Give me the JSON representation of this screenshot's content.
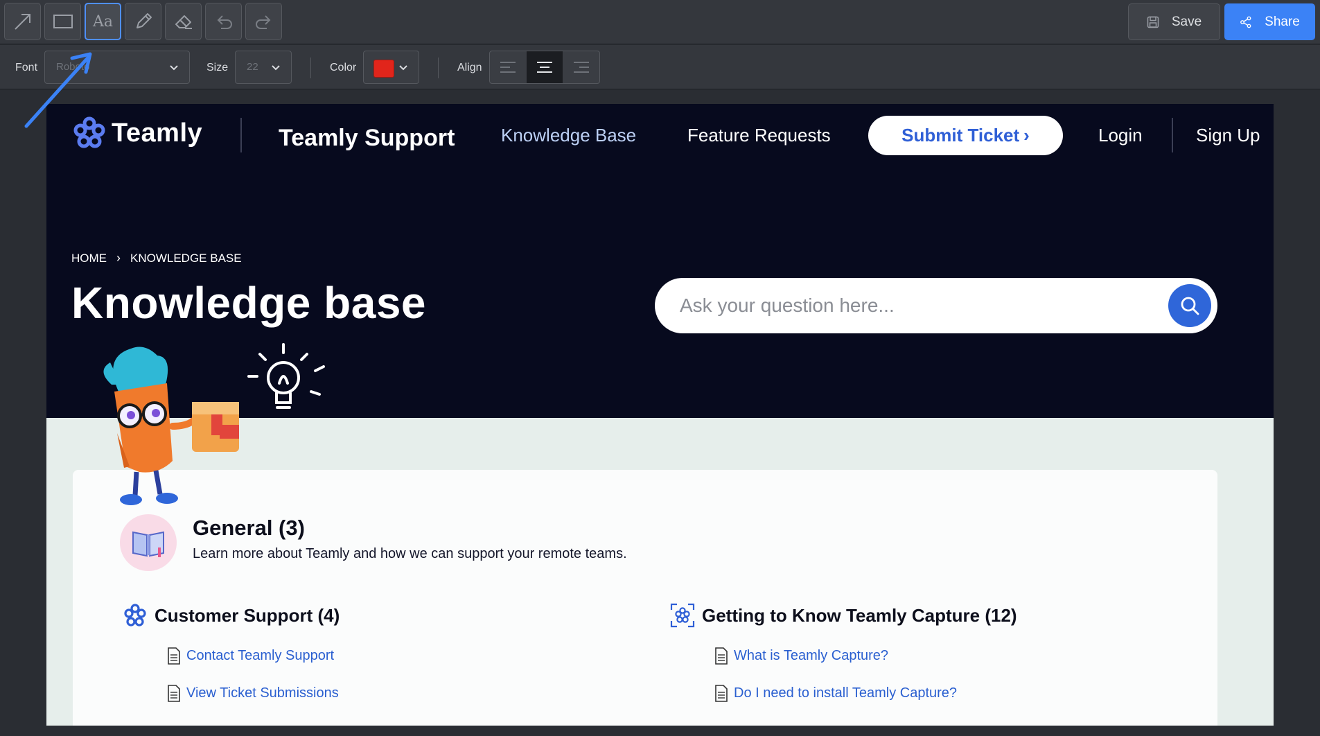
{
  "toolbar": {
    "tools": [
      {
        "name": "arrow-tool",
        "icon": "arrow-icon"
      },
      {
        "name": "rectangle-tool",
        "icon": "rectangle-icon"
      },
      {
        "name": "text-tool",
        "icon": "text-icon",
        "label": "Aa",
        "active": true
      },
      {
        "name": "pencil-tool",
        "icon": "pencil-icon"
      },
      {
        "name": "eraser-tool",
        "icon": "eraser-icon"
      },
      {
        "name": "undo-tool",
        "icon": "undo-icon"
      },
      {
        "name": "redo-tool",
        "icon": "redo-icon"
      }
    ],
    "save_label": "Save",
    "share_label": "Share",
    "share_color": "#3b82f6"
  },
  "format": {
    "font_label": "Font",
    "font_value": "Roboto",
    "size_label": "Size",
    "size_value": "22",
    "color_label": "Color",
    "color_value": "#e1251b",
    "align_label": "Align",
    "align_options": [
      "left",
      "center",
      "right"
    ],
    "align_selected": "center"
  },
  "annotation": {
    "color": "#3b82f6"
  },
  "site": {
    "logo_text": "Teamly",
    "support_title": "Teamly Support",
    "nav": {
      "knowledge_base": "Knowledge Base",
      "feature_requests": "Feature Requests",
      "submit_ticket": "Submit Ticket",
      "submit_ticket_chevron": "›",
      "login": "Login",
      "sign_up": "Sign Up"
    },
    "breadcrumb": {
      "home": "HOME",
      "separator": "›",
      "current": "KNOWLEDGE BASE"
    },
    "page_title": "Knowledge base",
    "search": {
      "placeholder": "Ask your question here..."
    },
    "general": {
      "title": "General (3)",
      "description": "Learn more about Teamly and how we can support your remote teams."
    },
    "sections": [
      {
        "title": "Customer Support (4)",
        "articles": [
          "Contact Teamly Support",
          "View Ticket Submissions"
        ]
      },
      {
        "title": "Getting to Know Teamly Capture (12)",
        "articles": [
          "What is Teamly Capture?",
          "Do I need to install Teamly Capture?"
        ]
      }
    ],
    "colors": {
      "hero_bg": "#070a1e",
      "lower_bg": "#e6eeeb",
      "link": "#2a5fd0",
      "accent": "#2f66d9"
    }
  }
}
